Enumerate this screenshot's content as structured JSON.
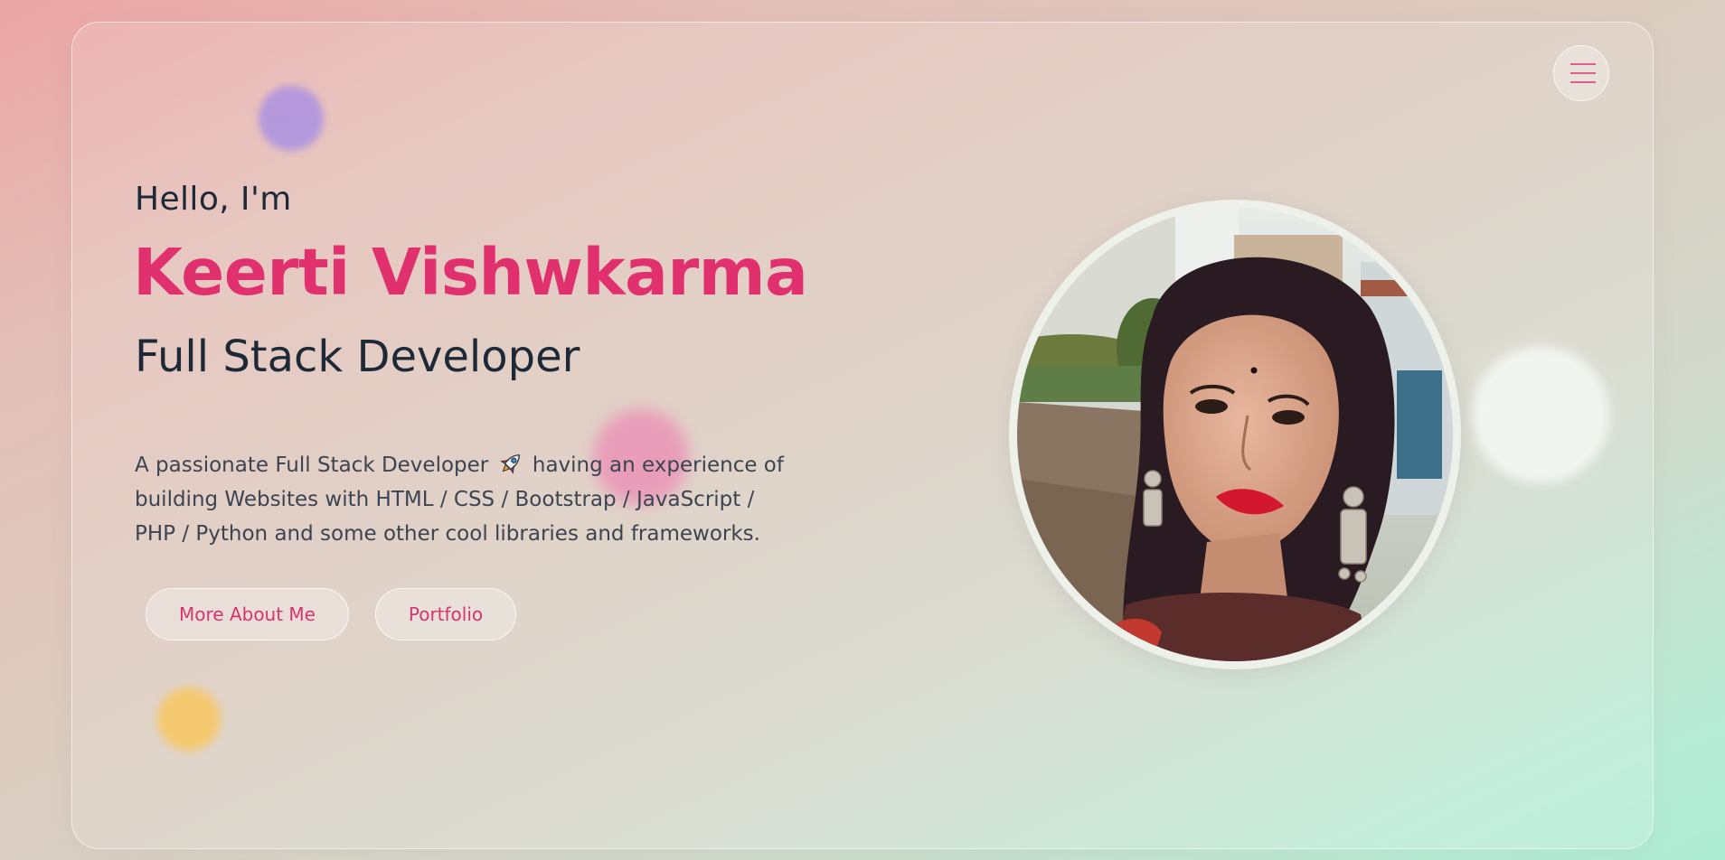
{
  "hero": {
    "greeting": "Hello, I'm",
    "name": "Keerti Vishwkarma",
    "role": "Full Stack Developer",
    "intro": {
      "line1_before": "A passionate Full Stack Developer",
      "line1_after": "having an experience of",
      "line2": "building Websites with HTML / CSS / Bootstrap / JavaScript /",
      "line3": "PHP / Python and some other cool libraries and frameworks."
    },
    "buttons": {
      "about": "More About Me",
      "portfolio": "Portfolio"
    }
  },
  "icons": {
    "menu": "hamburger-menu-icon",
    "rocket": "rocket-emoji-icon"
  },
  "colors": {
    "accent": "#e0316e",
    "text_dark": "#1e2938",
    "text_body": "#3c4452",
    "bg_start": "#eba5a5",
    "bg_end": "#aeecd4",
    "blob_purple": "#ac92e2",
    "blob_pink": "#ec8cb4",
    "blob_yellow": "#f7c765"
  }
}
